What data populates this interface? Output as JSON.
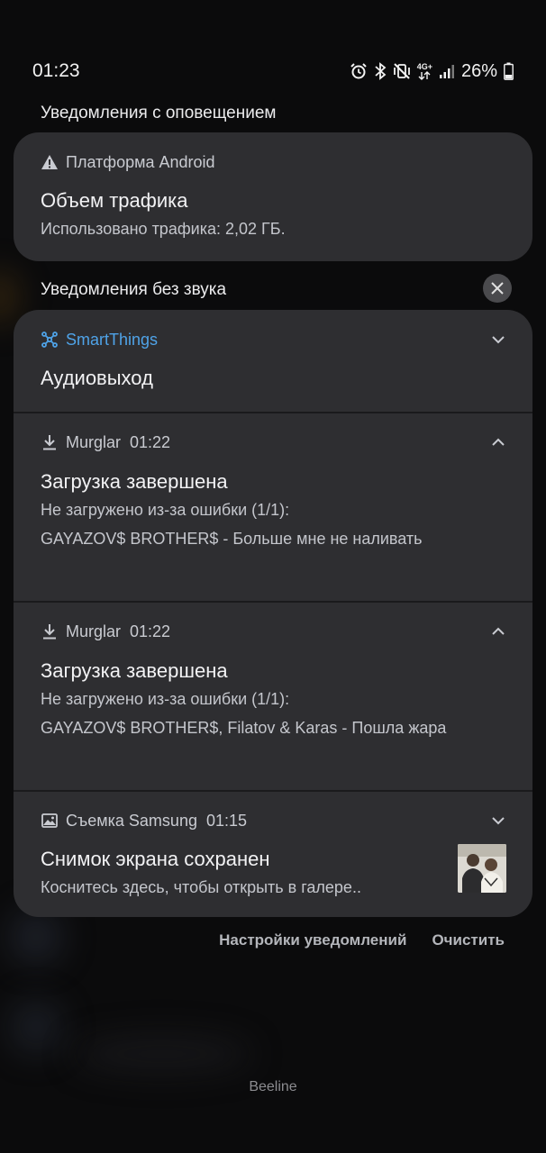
{
  "status_bar": {
    "time": "01:23",
    "network": "4G+",
    "battery": "26%",
    "icons": [
      "alarm-icon",
      "bluetooth-icon",
      "vibrate-mute-icon",
      "4g-plus-icon",
      "signal-icon",
      "battery-icon"
    ]
  },
  "sections": {
    "alerting": "Уведомления с оповещением",
    "silent": "Уведомления без звука"
  },
  "android": {
    "app": "Платформа Android",
    "title": "Объем трафика",
    "text": "Использовано трафика: 2,02 ГБ."
  },
  "smartthings": {
    "app": "SmartThings",
    "title": "Аудиовыход",
    "accent_color": "#4fa3e8"
  },
  "murglar1": {
    "app": "Murglar",
    "time": "01:22",
    "title": "Загрузка завершена",
    "line1": "Не загружено из-за ошибки (1/1):",
    "line2": "GAYAZOV$ BROTHER$ - Больше мне не наливать"
  },
  "murglar2": {
    "app": "Murglar",
    "time": "01:22",
    "title": "Загрузка завершена",
    "line1": "Не загружено из-за ошибки (1/1):",
    "line2": "GAYAZOV$ BROTHER$, Filatov & Karas - Пошла жара"
  },
  "samsung": {
    "app": "Съемка Samsung",
    "time": "01:15",
    "title": "Снимок экрана сохранен",
    "text": "Коснитесь здесь, чтобы открыть в галере.."
  },
  "footer": {
    "settings": "Настройки уведомлений",
    "clear": "Очистить"
  },
  "carrier": "Beeline"
}
